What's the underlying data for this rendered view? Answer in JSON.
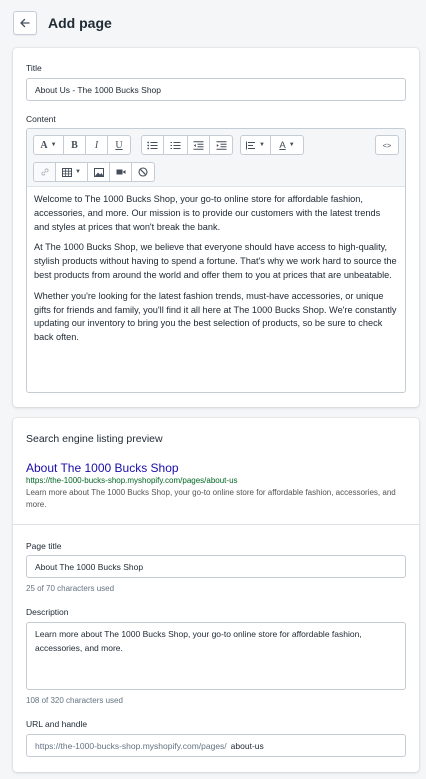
{
  "header": {
    "title": "Add page",
    "back_icon": "arrow-left-icon"
  },
  "title_field": {
    "label": "Title",
    "value": "About Us - The 1000 Bucks Shop"
  },
  "content": {
    "label": "Content",
    "toolbar": {
      "text_style": "A",
      "bold": "B",
      "italic": "I",
      "underline": "U",
      "text_color": "A",
      "html_toggle": "<>"
    },
    "paragraphs": [
      "Welcome to The 1000 Bucks Shop, your go-to online store for affordable fashion, accessories, and more. Our mission is to provide our customers with the latest trends and styles at prices that won't break the bank.",
      "At The 1000 Bucks Shop, we believe that everyone should have access to high-quality, stylish products without having to spend a fortune. That's why we work hard to source the best products from around the world and offer them to you at prices that are unbeatable.",
      "Whether you're looking for the latest fashion trends, must-have accessories, or unique gifts for friends and family, you'll find it all here at The 1000 Bucks Shop. We're constantly updating our inventory to bring you the best selection of products, so be sure to check back often."
    ]
  },
  "seo": {
    "heading": "Search engine listing preview",
    "preview_title": "About The 1000 Bucks Shop",
    "preview_url": "https://the-1000-bucks-shop.myshopify.com/pages/about-us",
    "preview_description": "Learn more about The 1000 Bucks Shop, your go-to online store for affordable fashion, accessories, and more.",
    "page_title_label": "Page title",
    "page_title_value": "About The 1000 Bucks Shop",
    "page_title_help": "25 of 70 characters used",
    "description_label": "Description",
    "description_value": "Learn more about The 1000 Bucks Shop, your go-to online store for affordable fashion, accessories, and more.",
    "description_help": "108 of 320 characters used",
    "url_label": "URL and handle",
    "url_prefix": "https://the-1000-bucks-shop.myshopify.com/pages/",
    "url_handle": "about-us"
  }
}
